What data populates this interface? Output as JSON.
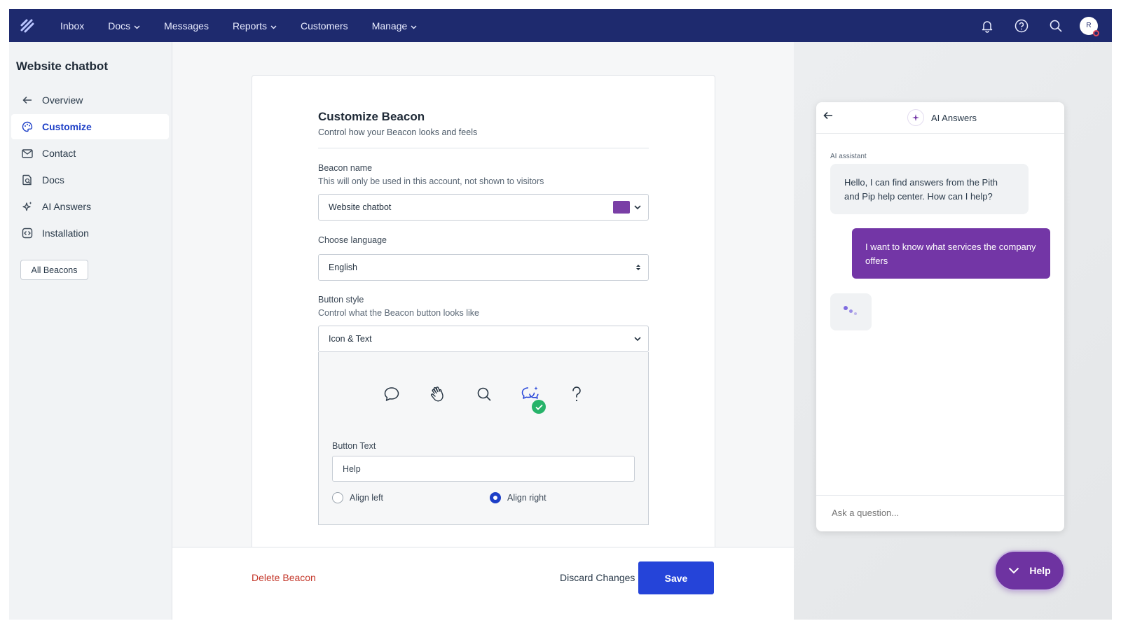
{
  "nav": {
    "items": [
      {
        "label": "Inbox",
        "dropdown": false
      },
      {
        "label": "Docs",
        "dropdown": true
      },
      {
        "label": "Messages",
        "dropdown": false
      },
      {
        "label": "Reports",
        "dropdown": true
      },
      {
        "label": "Customers",
        "dropdown": false
      },
      {
        "label": "Manage",
        "dropdown": true
      }
    ],
    "avatar_initial": "R"
  },
  "sidebar": {
    "title": "Website chatbot",
    "items": [
      {
        "label": "Overview",
        "icon": "arrow-left-icon"
      },
      {
        "label": "Customize",
        "icon": "palette-icon",
        "active": true
      },
      {
        "label": "Contact",
        "icon": "envelope-icon"
      },
      {
        "label": "Docs",
        "icon": "docs-search-icon"
      },
      {
        "label": "AI Answers",
        "icon": "sparkle-icon"
      },
      {
        "label": "Installation",
        "icon": "code-icon"
      }
    ],
    "all_beacons_label": "All Beacons"
  },
  "form": {
    "title": "Customize Beacon",
    "subtitle": "Control how your Beacon looks and feels",
    "beacon_name": {
      "label": "Beacon name",
      "hint": "This will only be used in this account, not shown to visitors",
      "value": "Website chatbot",
      "color": "#7a3fa6"
    },
    "language": {
      "label": "Choose language",
      "value": "English"
    },
    "button_style": {
      "label": "Button style",
      "hint": "Control what the Beacon button looks like",
      "value": "Icon & Text",
      "icons": [
        "chat-bubble-icon",
        "waving-hand-icon",
        "search-icon",
        "ai-chat-icon",
        "question-mark-icon"
      ],
      "selected_icon": "ai-chat-icon",
      "button_text_label": "Button Text",
      "button_text_value": "Help",
      "align_left_label": "Align left",
      "align_right_label": "Align right",
      "alignment": "right"
    }
  },
  "footer": {
    "delete_label": "Delete Beacon",
    "discard_label": "Discard Changes",
    "save_label": "Save"
  },
  "preview": {
    "header_title": "AI Answers",
    "sender_label": "AI assistant",
    "assistant_message": "Hello, I can find answers from the Pith and Pip help center. How can I help?",
    "user_message": "I want to know what services the company offers",
    "input_placeholder": "Ask a question...",
    "help_button_label": "Help",
    "accent_color": "#7336a6"
  },
  "colors": {
    "nav_bg": "#1e2a6e",
    "primary_button": "#2544d9",
    "delete_text": "#c4372a",
    "active_nav": "#1d3fc7"
  }
}
